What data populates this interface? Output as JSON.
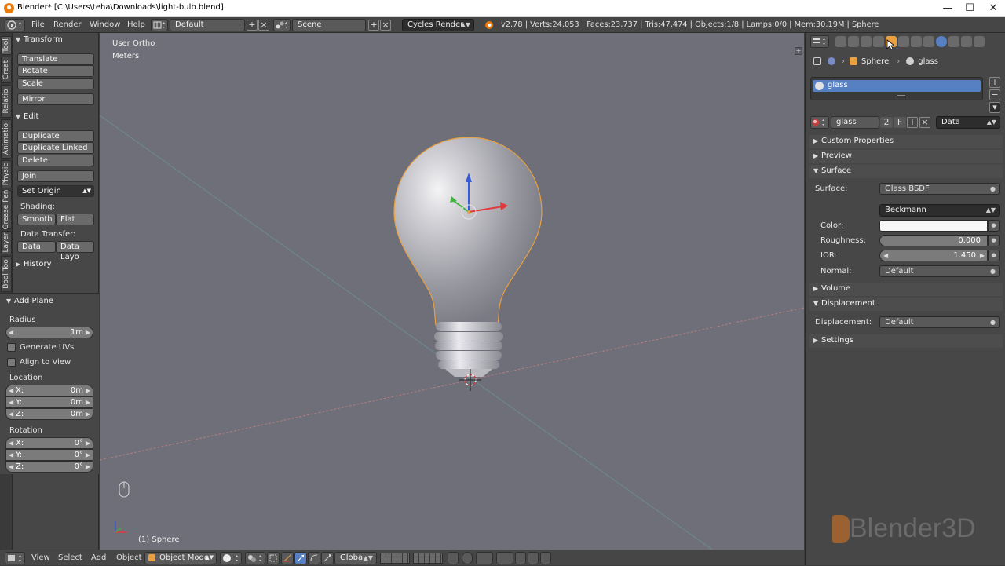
{
  "window": {
    "title": "Blender* [C:\\Users\\teha\\Downloads\\light-bulb.blend]",
    "minimize": "—",
    "maximize": "☐",
    "close": "✕"
  },
  "header": {
    "menus": [
      "File",
      "Render",
      "Window",
      "Help"
    ],
    "layout": "Default",
    "scene": "Scene",
    "engine": "Cycles Render",
    "stats": "v2.78 | Verts:24,053 | Faces:23,737 | Tris:47,474 | Objects:1/8 | Lamps:0/0 | Mem:30.19M | Sphere"
  },
  "tool_tabs": [
    "Tool",
    "Creat",
    "Relatio",
    "Animatio",
    "Physic",
    "Grease Pen",
    "Layer",
    "Bool Too"
  ],
  "tool_shelf": {
    "transform": {
      "title": "Transform",
      "buttons": [
        "Translate",
        "Rotate",
        "Scale",
        "Mirror"
      ]
    },
    "edit": {
      "title": "Edit",
      "buttons": [
        "Duplicate",
        "Duplicate Linked",
        "Delete",
        "Join"
      ],
      "set_origin": "Set Origin",
      "shading_label": "Shading:",
      "smooth": "Smooth",
      "flat": "Flat",
      "data_transfer_label": "Data Transfer:",
      "data": "Data",
      "data_layout": "Data Layo"
    },
    "history": "History",
    "add_plane": {
      "title": "Add Plane",
      "radius_label": "Radius",
      "radius_value": "1m",
      "generate_uvs": "Generate UVs",
      "align_to_view": "Align to View",
      "location_label": "Location",
      "location": [
        {
          "axis": "X:",
          "value": "0m"
        },
        {
          "axis": "Y:",
          "value": "0m"
        },
        {
          "axis": "Z:",
          "value": "0m"
        }
      ],
      "rotation_label": "Rotation",
      "rotation": [
        {
          "axis": "X:",
          "value": "0°"
        },
        {
          "axis": "Y:",
          "value": "0°"
        },
        {
          "axis": "Z:",
          "value": "0°"
        }
      ]
    }
  },
  "viewport": {
    "view_name": "User Ortho",
    "units": "Meters",
    "object_label": "(1) Sphere"
  },
  "bottom_bar": {
    "menus": [
      "View",
      "Select",
      "Add",
      "Object"
    ],
    "mode": "Object Mode",
    "orientation": "Global"
  },
  "properties": {
    "breadcrumb": {
      "object": "Sphere",
      "material": "glass"
    },
    "material_slot": "glass",
    "material_name": "glass",
    "users": "2",
    "fake_user": "F",
    "link": "Data",
    "panels": {
      "custom_properties": "Custom Properties",
      "preview": "Preview",
      "surface": "Surface",
      "volume": "Volume",
      "displacement": "Displacement",
      "settings": "Settings"
    },
    "surface": {
      "surface_label": "Surface:",
      "surface_value": "Glass BSDF",
      "distribution": "Beckmann",
      "color_label": "Color:",
      "roughness_label": "Roughness:",
      "roughness_value": "0.000",
      "ior_label": "IOR:",
      "ior_value": "1.450",
      "normal_label": "Normal:",
      "normal_value": "Default"
    },
    "displacement": {
      "label": "Displacement:",
      "value": "Default"
    }
  },
  "watermark": "Blender3D",
  "colors": {
    "accent_orange": "#e87d0d",
    "selection_blue": "#5680c2",
    "viewport_bg": "#6f6f7a"
  }
}
